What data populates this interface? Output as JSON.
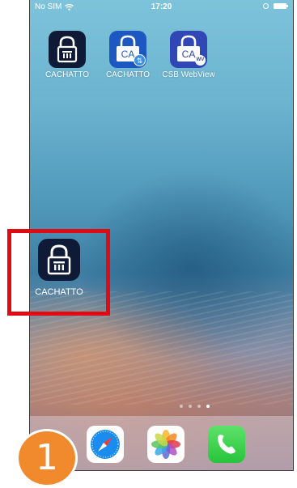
{
  "status_bar": {
    "carrier": "No SIM",
    "time": "17:20"
  },
  "home_screen": {
    "apps": [
      {
        "label": "CACHATTO"
      },
      {
        "label": "CACHATTO"
      },
      {
        "label": "CSB WebView"
      }
    ],
    "icon_texts": {
      "ca": "CA",
      "wv": "WV"
    },
    "highlighted_app": {
      "label": "CACHATTO"
    },
    "page_count": 4,
    "active_page": 4
  },
  "dock": {
    "apps": [
      "safari-icon",
      "photos-icon",
      "phone-icon"
    ]
  },
  "step_marker": {
    "label": "1"
  },
  "colors": {
    "highlight_border": "#e10a13",
    "step_badge": "#f08a2c"
  }
}
